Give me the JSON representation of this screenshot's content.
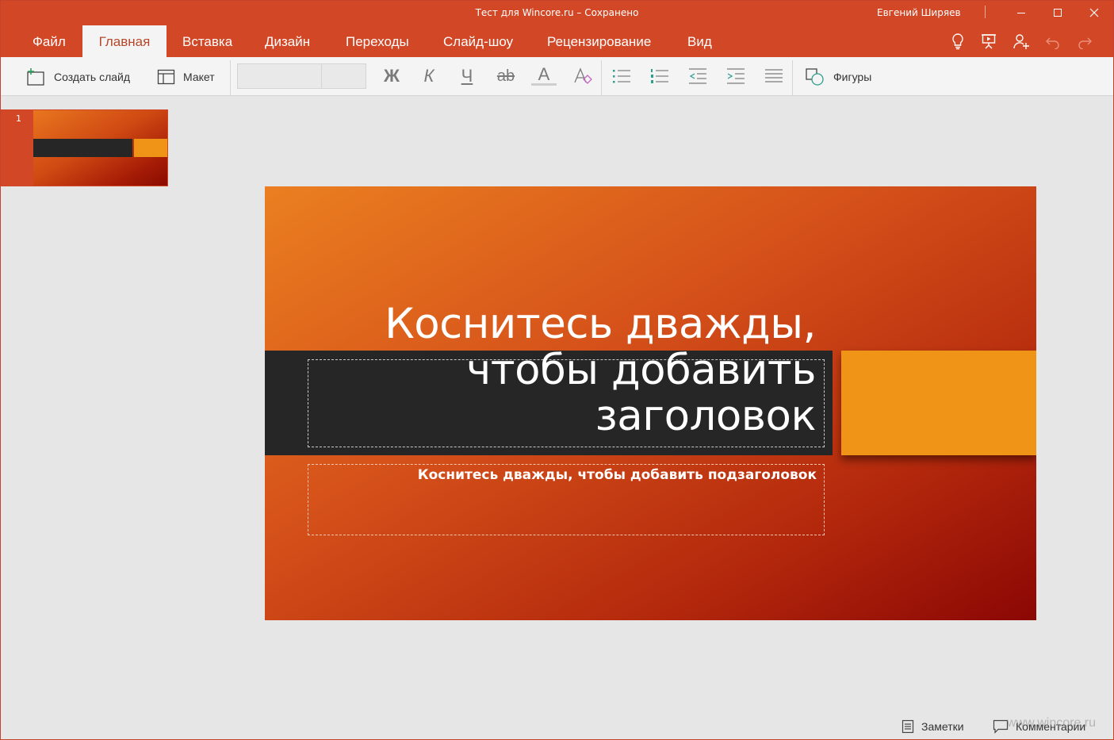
{
  "window": {
    "title": "Тест для Wincore.ru – Сохранено",
    "user": "Евгений Ширяев"
  },
  "ribbon": {
    "tabs": [
      {
        "label": "Файл"
      },
      {
        "label": "Главная",
        "active": true
      },
      {
        "label": "Вставка"
      },
      {
        "label": "Дизайн"
      },
      {
        "label": "Переходы"
      },
      {
        "label": "Слайд-шоу"
      },
      {
        "label": "Рецензирование"
      },
      {
        "label": "Вид"
      }
    ],
    "right_icons": [
      "lightbulb-icon",
      "present-icon",
      "share-person-icon",
      "undo-icon",
      "redo-icon"
    ]
  },
  "toolbar": {
    "new_slide": "Создать слайд",
    "layout": "Макет",
    "font_name": "",
    "font_size": "",
    "bold": "Ж",
    "italic": "К",
    "underline": "Ч",
    "strike": "ab",
    "font_color": "A",
    "shapes": "Фигуры"
  },
  "thumbnails": [
    {
      "number": "1"
    }
  ],
  "slide": {
    "title": "Коснитесь дважды, чтобы добавить заголовок",
    "subtitle": "Коснитесь дважды, чтобы добавить подзаголовок"
  },
  "statusbar": {
    "notes": "Заметки",
    "comments": "Комментарии"
  },
  "watermark": {
    "text": "www.wincore.ru"
  },
  "colors": {
    "brand": "#d24726",
    "slide_dark": "#262626",
    "slide_accent": "#f09417",
    "active_tab_text": "#b7472a"
  }
}
